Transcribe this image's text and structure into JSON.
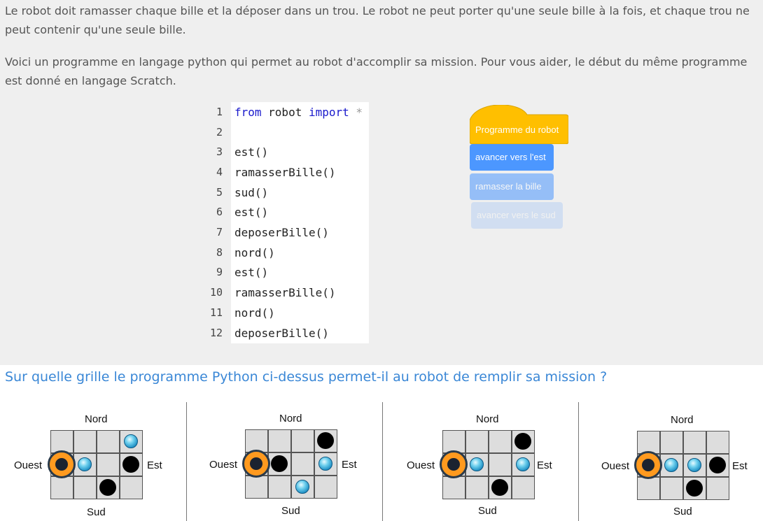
{
  "intro": {
    "paragraph1": "Le robot doit ramasser chaque bille et la déposer dans un trou. Le robot ne peut porter qu'une seule bille à la fois, et chaque trou ne peut contenir qu'une seule bille.",
    "paragraph2": "Voici un programme en langage python qui permet au robot d'accomplir sa mission. Pour vous aider, le début du même programme est donné en langage Scratch."
  },
  "code": {
    "first_line": {
      "kw1": "from",
      "mod": " robot ",
      "kw2": "import",
      "star": " *"
    },
    "lines": [
      {
        "num": "1",
        "text": ""
      },
      {
        "num": "2",
        "text": ""
      },
      {
        "num": "3",
        "text": "est()"
      },
      {
        "num": "4",
        "text": "ramasserBille()"
      },
      {
        "num": "5",
        "text": "sud()"
      },
      {
        "num": "6",
        "text": "est()"
      },
      {
        "num": "7",
        "text": "deposerBille()"
      },
      {
        "num": "8",
        "text": "nord()"
      },
      {
        "num": "9",
        "text": "est()"
      },
      {
        "num": "10",
        "text": "ramasserBille()"
      },
      {
        "num": "11",
        "text": "nord()"
      },
      {
        "num": "12",
        "text": "deposerBille()"
      }
    ]
  },
  "scratch": {
    "hat": "Programme du robot",
    "blocks": [
      "avancer vers l'est",
      "ramasser la bille",
      "avancer vers le sud"
    ],
    "colors": {
      "hat": "#ffbf00",
      "motion": "#4c97ff"
    }
  },
  "question": "Sur quelle grille le programme Python ci-dessus permet-il au robot de remplir sa mission ?",
  "options": [
    {
      "nord": "Nord",
      "sud": "Sud",
      "ouest": "Ouest",
      "est": "Est"
    },
    {
      "nord": "Nord",
      "sud": "Sud",
      "ouest": "Ouest",
      "est": "Est"
    },
    {
      "nord": "Nord",
      "sud": "Sud",
      "ouest": "Ouest",
      "est": "Est"
    },
    {
      "nord": "Nord",
      "sud": "Sud",
      "ouest": "Ouest",
      "est": "Est"
    }
  ],
  "grids": [
    {
      "rows": 3,
      "cols": 4,
      "robot": [
        1,
        0
      ],
      "marbles": [
        [
          0,
          3
        ],
        [
          1,
          1
        ]
      ],
      "holes": [
        [
          1,
          3
        ],
        [
          2,
          2
        ]
      ]
    },
    {
      "rows": 3,
      "cols": 4,
      "robot": [
        1,
        0
      ],
      "marbles": [
        [
          1,
          3
        ],
        [
          2,
          2
        ]
      ],
      "holes": [
        [
          0,
          3
        ],
        [
          1,
          1
        ]
      ]
    },
    {
      "rows": 3,
      "cols": 4,
      "robot": [
        1,
        0
      ],
      "marbles": [
        [
          1,
          1
        ],
        [
          1,
          3
        ]
      ],
      "holes": [
        [
          0,
          3
        ],
        [
          2,
          2
        ]
      ]
    },
    {
      "rows": 3,
      "cols": 4,
      "robot": [
        1,
        0
      ],
      "marbles": [
        [
          1,
          1
        ],
        [
          1,
          2
        ]
      ],
      "holes": [
        [
          1,
          3
        ],
        [
          2,
          2
        ]
      ]
    }
  ]
}
